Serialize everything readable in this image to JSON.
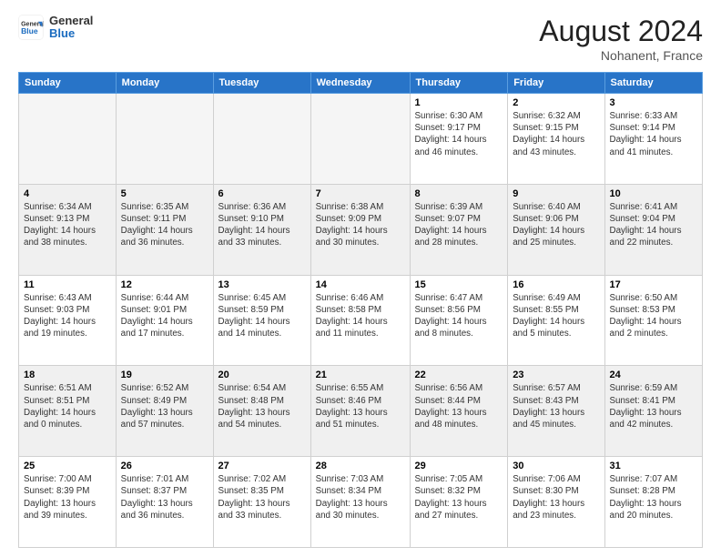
{
  "header": {
    "logo": {
      "general": "General",
      "blue": "Blue"
    },
    "title": "August 2024",
    "location": "Nohanent, France"
  },
  "weekdays": [
    "Sunday",
    "Monday",
    "Tuesday",
    "Wednesday",
    "Thursday",
    "Friday",
    "Saturday"
  ],
  "weeks": [
    [
      {
        "empty": true
      },
      {
        "empty": true
      },
      {
        "empty": true
      },
      {
        "empty": true
      },
      {
        "day": "1",
        "sunrise": "Sunrise: 6:30 AM",
        "sunset": "Sunset: 9:17 PM",
        "daylight": "Daylight: 14 hours and 46 minutes."
      },
      {
        "day": "2",
        "sunrise": "Sunrise: 6:32 AM",
        "sunset": "Sunset: 9:15 PM",
        "daylight": "Daylight: 14 hours and 43 minutes."
      },
      {
        "day": "3",
        "sunrise": "Sunrise: 6:33 AM",
        "sunset": "Sunset: 9:14 PM",
        "daylight": "Daylight: 14 hours and 41 minutes."
      }
    ],
    [
      {
        "day": "4",
        "sunrise": "Sunrise: 6:34 AM",
        "sunset": "Sunset: 9:13 PM",
        "daylight": "Daylight: 14 hours and 38 minutes."
      },
      {
        "day": "5",
        "sunrise": "Sunrise: 6:35 AM",
        "sunset": "Sunset: 9:11 PM",
        "daylight": "Daylight: 14 hours and 36 minutes."
      },
      {
        "day": "6",
        "sunrise": "Sunrise: 6:36 AM",
        "sunset": "Sunset: 9:10 PM",
        "daylight": "Daylight: 14 hours and 33 minutes."
      },
      {
        "day": "7",
        "sunrise": "Sunrise: 6:38 AM",
        "sunset": "Sunset: 9:09 PM",
        "daylight": "Daylight: 14 hours and 30 minutes."
      },
      {
        "day": "8",
        "sunrise": "Sunrise: 6:39 AM",
        "sunset": "Sunset: 9:07 PM",
        "daylight": "Daylight: 14 hours and 28 minutes."
      },
      {
        "day": "9",
        "sunrise": "Sunrise: 6:40 AM",
        "sunset": "Sunset: 9:06 PM",
        "daylight": "Daylight: 14 hours and 25 minutes."
      },
      {
        "day": "10",
        "sunrise": "Sunrise: 6:41 AM",
        "sunset": "Sunset: 9:04 PM",
        "daylight": "Daylight: 14 hours and 22 minutes."
      }
    ],
    [
      {
        "day": "11",
        "sunrise": "Sunrise: 6:43 AM",
        "sunset": "Sunset: 9:03 PM",
        "daylight": "Daylight: 14 hours and 19 minutes."
      },
      {
        "day": "12",
        "sunrise": "Sunrise: 6:44 AM",
        "sunset": "Sunset: 9:01 PM",
        "daylight": "Daylight: 14 hours and 17 minutes."
      },
      {
        "day": "13",
        "sunrise": "Sunrise: 6:45 AM",
        "sunset": "Sunset: 8:59 PM",
        "daylight": "Daylight: 14 hours and 14 minutes."
      },
      {
        "day": "14",
        "sunrise": "Sunrise: 6:46 AM",
        "sunset": "Sunset: 8:58 PM",
        "daylight": "Daylight: 14 hours and 11 minutes."
      },
      {
        "day": "15",
        "sunrise": "Sunrise: 6:47 AM",
        "sunset": "Sunset: 8:56 PM",
        "daylight": "Daylight: 14 hours and 8 minutes."
      },
      {
        "day": "16",
        "sunrise": "Sunrise: 6:49 AM",
        "sunset": "Sunset: 8:55 PM",
        "daylight": "Daylight: 14 hours and 5 minutes."
      },
      {
        "day": "17",
        "sunrise": "Sunrise: 6:50 AM",
        "sunset": "Sunset: 8:53 PM",
        "daylight": "Daylight: 14 hours and 2 minutes."
      }
    ],
    [
      {
        "day": "18",
        "sunrise": "Sunrise: 6:51 AM",
        "sunset": "Sunset: 8:51 PM",
        "daylight": "Daylight: 14 hours and 0 minutes."
      },
      {
        "day": "19",
        "sunrise": "Sunrise: 6:52 AM",
        "sunset": "Sunset: 8:49 PM",
        "daylight": "Daylight: 13 hours and 57 minutes."
      },
      {
        "day": "20",
        "sunrise": "Sunrise: 6:54 AM",
        "sunset": "Sunset: 8:48 PM",
        "daylight": "Daylight: 13 hours and 54 minutes."
      },
      {
        "day": "21",
        "sunrise": "Sunrise: 6:55 AM",
        "sunset": "Sunset: 8:46 PM",
        "daylight": "Daylight: 13 hours and 51 minutes."
      },
      {
        "day": "22",
        "sunrise": "Sunrise: 6:56 AM",
        "sunset": "Sunset: 8:44 PM",
        "daylight": "Daylight: 13 hours and 48 minutes."
      },
      {
        "day": "23",
        "sunrise": "Sunrise: 6:57 AM",
        "sunset": "Sunset: 8:43 PM",
        "daylight": "Daylight: 13 hours and 45 minutes."
      },
      {
        "day": "24",
        "sunrise": "Sunrise: 6:59 AM",
        "sunset": "Sunset: 8:41 PM",
        "daylight": "Daylight: 13 hours and 42 minutes."
      }
    ],
    [
      {
        "day": "25",
        "sunrise": "Sunrise: 7:00 AM",
        "sunset": "Sunset: 8:39 PM",
        "daylight": "Daylight: 13 hours and 39 minutes."
      },
      {
        "day": "26",
        "sunrise": "Sunrise: 7:01 AM",
        "sunset": "Sunset: 8:37 PM",
        "daylight": "Daylight: 13 hours and 36 minutes."
      },
      {
        "day": "27",
        "sunrise": "Sunrise: 7:02 AM",
        "sunset": "Sunset: 8:35 PM",
        "daylight": "Daylight: 13 hours and 33 minutes."
      },
      {
        "day": "28",
        "sunrise": "Sunrise: 7:03 AM",
        "sunset": "Sunset: 8:34 PM",
        "daylight": "Daylight: 13 hours and 30 minutes."
      },
      {
        "day": "29",
        "sunrise": "Sunrise: 7:05 AM",
        "sunset": "Sunset: 8:32 PM",
        "daylight": "Daylight: 13 hours and 27 minutes."
      },
      {
        "day": "30",
        "sunrise": "Sunrise: 7:06 AM",
        "sunset": "Sunset: 8:30 PM",
        "daylight": "Daylight: 13 hours and 23 minutes."
      },
      {
        "day": "31",
        "sunrise": "Sunrise: 7:07 AM",
        "sunset": "Sunset: 8:28 PM",
        "daylight": "Daylight: 13 hours and 20 minutes."
      }
    ]
  ]
}
